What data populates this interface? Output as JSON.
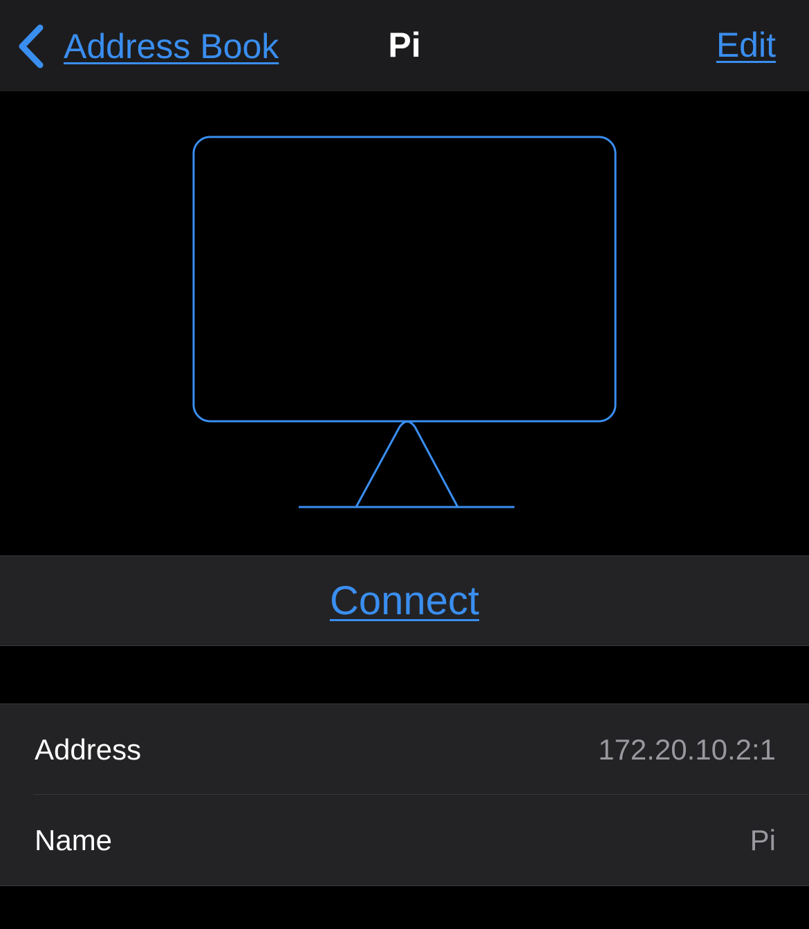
{
  "navbar": {
    "back_label": "Address Book",
    "back_icon": "chevron-left-icon",
    "title": "Pi",
    "edit_label": "Edit"
  },
  "hero": {
    "icon": "monitor-icon",
    "accent_color": "#3a8ef0"
  },
  "actions": {
    "connect_label": "Connect"
  },
  "details": [
    {
      "label": "Address",
      "value": "172.20.10.2:1"
    },
    {
      "label": "Name",
      "value": "Pi"
    }
  ],
  "colors": {
    "background": "#000000",
    "navbar_bg": "#1c1c1e",
    "cell_bg": "#232325",
    "accent": "#3a8ef0",
    "secondary_text": "#98989e"
  }
}
